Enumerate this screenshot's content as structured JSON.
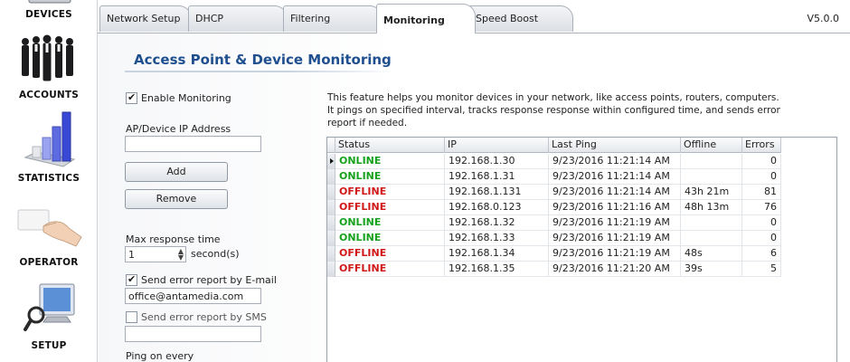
{
  "nav": {
    "items": [
      {
        "id": "devices",
        "label": "DEVICES",
        "icon": "devices-icon"
      },
      {
        "id": "accounts",
        "label": "ACCOUNTS",
        "icon": "accounts-icon"
      },
      {
        "id": "statistics",
        "label": "STATISTICS",
        "icon": "statistics-icon"
      },
      {
        "id": "operator",
        "label": "OPERATOR",
        "icon": "operator-icon"
      },
      {
        "id": "setup",
        "label": "SETUP",
        "icon": "setup-icon"
      }
    ]
  },
  "tabs": [
    {
      "label": "Network Setup",
      "active": false
    },
    {
      "label": "DHCP",
      "active": false
    },
    {
      "label": "Filtering",
      "active": false
    },
    {
      "label": "Monitoring",
      "active": true
    },
    {
      "label": "Speed Boost",
      "active": false
    }
  ],
  "version": "V5.0.0",
  "page": {
    "title": "Access Point & Device Monitoring"
  },
  "form": {
    "enable_monitoring": {
      "label": "Enable Monitoring",
      "checked": true
    },
    "ip_address": {
      "label": "AP/Device IP Address",
      "value": ""
    },
    "add_label": "Add",
    "remove_label": "Remove",
    "max_response": {
      "label": "Max response time",
      "value": "1",
      "unit": "second(s)"
    },
    "email_report": {
      "label": "Send error report by E-mail",
      "checked": true,
      "value": "office@antamedia.com"
    },
    "sms_report": {
      "label": "Send error report by SMS",
      "checked": false,
      "value": ""
    },
    "ping_label": "Ping on every"
  },
  "description": "This feature helps you monitor devices in your network, like access points, routers, computers. It pings on specified interval, tracks response response within configured time, and sends error report if needed.",
  "table": {
    "columns": [
      "Status",
      "IP",
      "Last Ping",
      "Offline",
      "Errors"
    ],
    "rows": [
      {
        "status": "ONLINE",
        "ip": "192.168.1.30",
        "last_ping": "9/23/2016 11:21:14 AM",
        "offline": "",
        "errors": "0"
      },
      {
        "status": "ONLINE",
        "ip": "192.168.1.31",
        "last_ping": "9/23/2016 11:21:14 AM",
        "offline": "",
        "errors": "0"
      },
      {
        "status": "OFFLINE",
        "ip": "192.168.1.131",
        "last_ping": "9/23/2016 11:21:14 AM",
        "offline": "43h 21m",
        "errors": "81"
      },
      {
        "status": "OFFLINE",
        "ip": "192.168.0.123",
        "last_ping": "9/23/2016 11:21:16 AM",
        "offline": "48h 13m",
        "errors": "76"
      },
      {
        "status": "ONLINE",
        "ip": "192.168.1.32",
        "last_ping": "9/23/2016 11:21:19 AM",
        "offline": "",
        "errors": "0"
      },
      {
        "status": "ONLINE",
        "ip": "192.168.1.33",
        "last_ping": "9/23/2016 11:21:19 AM",
        "offline": "",
        "errors": "0"
      },
      {
        "status": "OFFLINE",
        "ip": "192.168.1.34",
        "last_ping": "9/23/2016 11:21:19 AM",
        "offline": "48s",
        "errors": "6"
      },
      {
        "status": "OFFLINE",
        "ip": "192.168.1.35",
        "last_ping": "9/23/2016 11:21:20 AM",
        "offline": "39s",
        "errors": "5"
      }
    ]
  },
  "colors": {
    "online": "#17a21d",
    "offline": "#d01818",
    "title": "#1f4f8f"
  }
}
